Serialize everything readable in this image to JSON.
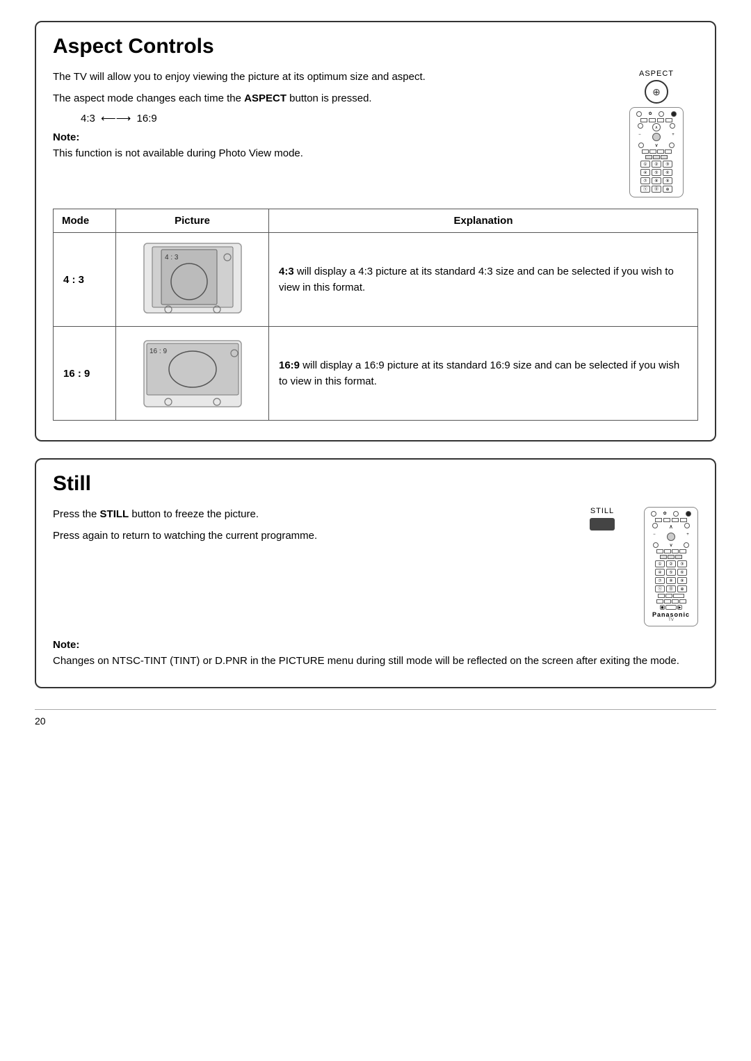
{
  "aspect_controls": {
    "title": "Aspect Controls",
    "intro": "The TV will allow you to enjoy viewing the picture at its optimum size and aspect.",
    "aspect_label": "ASPECT",
    "mode_change": "The aspect mode changes each time the ",
    "aspect_bold": "ASPECT",
    "mode_change_end": " button is pressed.",
    "arrow_text": "4:3  ←→  16:9",
    "note_label": "Note:",
    "note_text": "This function is not available during Photo View mode.",
    "table": {
      "headers": [
        "Mode",
        "Picture",
        "Explanation"
      ],
      "rows": [
        {
          "mode": "4 : 3",
          "picture_label": "4 : 3",
          "explanation_bold": "4:3",
          "explanation": " will display a 4:3 picture at its standard 4:3 size and can be selected if you wish to view in this format."
        },
        {
          "mode": "16 : 9",
          "picture_label": "16 : 9",
          "explanation_bold": "16:9",
          "explanation": " will display a 16:9 picture at its standard 16:9 size and can be selected if you wish to view in this format."
        }
      ]
    }
  },
  "still": {
    "title": "Still",
    "still_label": "STILL",
    "line1_start": "Press the ",
    "line1_bold": "STILL",
    "line1_end": " button to freeze the picture.",
    "line2": "Press again to return to watching the current programme.",
    "note_label": "Note:",
    "note_text": "Changes on NTSC-TINT (TINT) or D.PNR in the PICTURE menu during still mode will be reflected on the screen after exiting the mode."
  },
  "page_number": "20"
}
